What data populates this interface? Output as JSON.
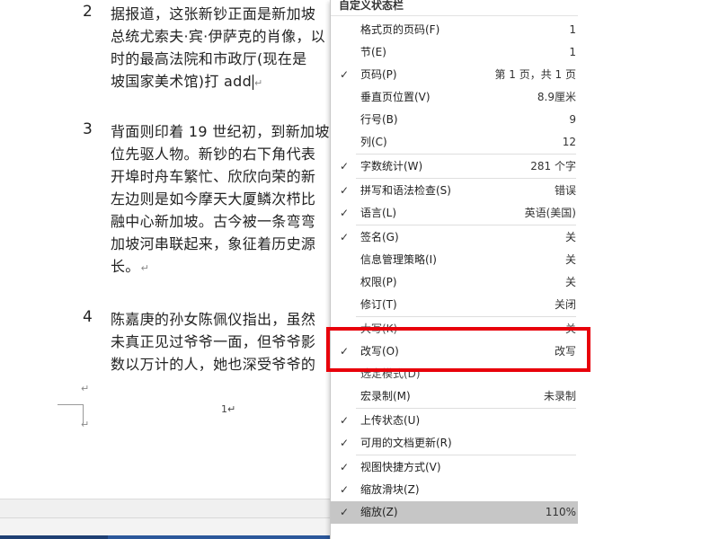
{
  "document": {
    "paragraphs": [
      {
        "num": "2",
        "lines": [
          "据报道，这张新钞正面是新加坡",
          "总统尤索夫·宾·伊萨克的肖像，以",
          "时的最高法院和市政厅(现在是",
          "坡国家美术馆)打 add"
        ]
      },
      {
        "num": "3",
        "lines": [
          "背面则印着 19 世纪初，到新加坡",
          "位先驱人物。新钞的右下角代表",
          "开埠时舟车繁忙、欣欣向荣的新",
          "左边则是如今摩天大厦鳞次栉比",
          "融中心新加坡。古今被一条弯弯",
          "加坡河串联起来，象征着历史源",
          "长。"
        ]
      },
      {
        "num": "4",
        "lines": [
          "陈嘉庚的孙女陈佩仪指出，虽然",
          "未真正见过爷爷一面，但爷爷影",
          "数以万计的人，她也深受爷爷的"
        ]
      }
    ],
    "para_mark": "↵",
    "page_number": "1↵"
  },
  "menu": {
    "title": "自定义状态栏",
    "check_symbol": "✓",
    "items": [
      {
        "label": "格式页的页码(F)",
        "value": "1",
        "checked": false
      },
      {
        "label": "节(E)",
        "value": "1",
        "checked": false
      },
      {
        "label": "页码(P)",
        "value": "第 1 页，共 1 页",
        "checked": true
      },
      {
        "label": "垂直页位置(V)",
        "value": "8.9厘米",
        "checked": false
      },
      {
        "label": "行号(B)",
        "value": "9",
        "checked": false
      },
      {
        "label": "列(C)",
        "value": "12",
        "checked": false
      },
      {
        "label": "字数统计(W)",
        "value": "281 个字",
        "checked": true
      },
      {
        "label": "拼写和语法检查(S)",
        "value": "错误",
        "checked": true
      },
      {
        "label": "语言(L)",
        "value": "英语(美国)",
        "checked": true
      },
      {
        "label": "签名(G)",
        "value": "关",
        "checked": true
      },
      {
        "label": "信息管理策略(I)",
        "value": "关",
        "checked": false
      },
      {
        "label": "权限(P)",
        "value": "关",
        "checked": false
      },
      {
        "label": "修订(T)",
        "value": "关闭",
        "checked": false
      },
      {
        "label": "大写(K)",
        "value": "关",
        "checked": false
      },
      {
        "label": "改写(O)",
        "value": "改写",
        "checked": true
      },
      {
        "label": "选定模式(D)",
        "value": "",
        "checked": false
      },
      {
        "label": "宏录制(M)",
        "value": "未录制",
        "checked": false
      },
      {
        "label": "上传状态(U)",
        "value": "",
        "checked": true
      },
      {
        "label": "可用的文档更新(R)",
        "value": "",
        "checked": true
      },
      {
        "label": "视图快捷方式(V)",
        "value": "",
        "checked": true
      },
      {
        "label": "缩放滑块(Z)",
        "value": "",
        "checked": true
      },
      {
        "label": "缩放(Z)",
        "value": "110%",
        "checked": true
      }
    ]
  },
  "colors": {
    "highlight_box": "#e8000a",
    "menu_hover": "#c6c6c6",
    "taskbar": "#2b579a"
  }
}
